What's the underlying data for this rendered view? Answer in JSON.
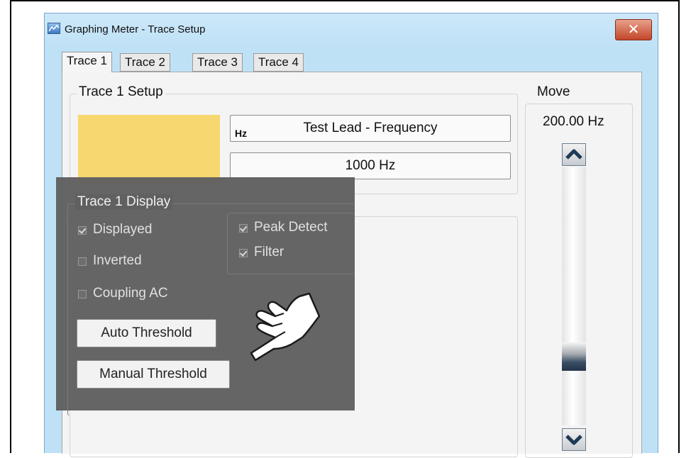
{
  "window": {
    "title": "Graphing Meter - Trace Setup",
    "close_label": "✕"
  },
  "tabs": [
    {
      "label": "Trace 1",
      "active": true
    },
    {
      "label": "Trace 2",
      "active": false
    },
    {
      "label": "Trace 3",
      "active": false
    },
    {
      "label": "Trace 4",
      "active": false
    }
  ],
  "trace_setup": {
    "legend": "Trace 1 Setup",
    "color": "#f6d770",
    "source_unit": "Hz",
    "source_label": "Test Lead - Frequency",
    "range_value": "1000 Hz"
  },
  "move": {
    "legend": "Move",
    "value": "200.00 Hz"
  },
  "trace_display": {
    "legend": "Trace 1 Display",
    "options": [
      {
        "label": "Displayed",
        "checked": true
      },
      {
        "label": "Inverted",
        "checked": false
      },
      {
        "label": "Coupling AC",
        "checked": false
      }
    ],
    "filters": [
      {
        "label": "Peak Detect",
        "checked": true
      },
      {
        "label": "Filter",
        "checked": true
      }
    ],
    "auto_threshold_label": "Auto Threshold",
    "manual_threshold_label": "Manual Threshold"
  },
  "icons": [
    "app-icon",
    "close-icon",
    "scroll-up-icon",
    "scroll-down-icon",
    "pointing-hand-icon"
  ]
}
